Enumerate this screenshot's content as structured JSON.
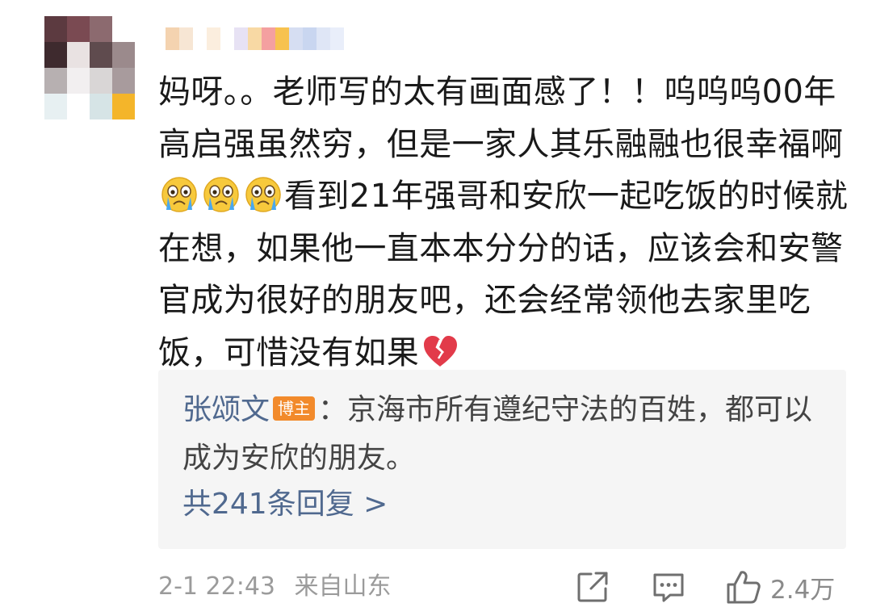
{
  "comment": {
    "body_segments": [
      "妈呀。。老师写的太有画面感了！！呜呜呜00年高启强虽然穷，但是一家人其乐融融也很幸福啊",
      "看到21年强哥和安欣一起吃饭的时候就在想，如果他一直本本分分的话，应该会和安警官成为很好的朋友吧，还会经常领他去家里吃饭，可惜没有如果"
    ],
    "emojis": [
      "crying-face-emoji",
      "crying-face-emoji",
      "crying-face-emoji",
      "broken-heart-emoji"
    ]
  },
  "reply": {
    "author": "张颂文",
    "badge": "博主",
    "separator": "：",
    "text": "京海市所有遵纪守法的百姓，都可以成为安欣的朋友。",
    "view_all": "共241条回复 >"
  },
  "meta": {
    "timestamp": "2-1 22:43",
    "location": "来自山东",
    "like_count": "2.4万"
  },
  "colors": {
    "link": "#50698f",
    "badge": "#f28a2b",
    "reply_bg": "#f5f5f5",
    "meta": "#9b9b9b"
  },
  "icons": [
    "share-icon",
    "comment-icon",
    "like-icon"
  ]
}
